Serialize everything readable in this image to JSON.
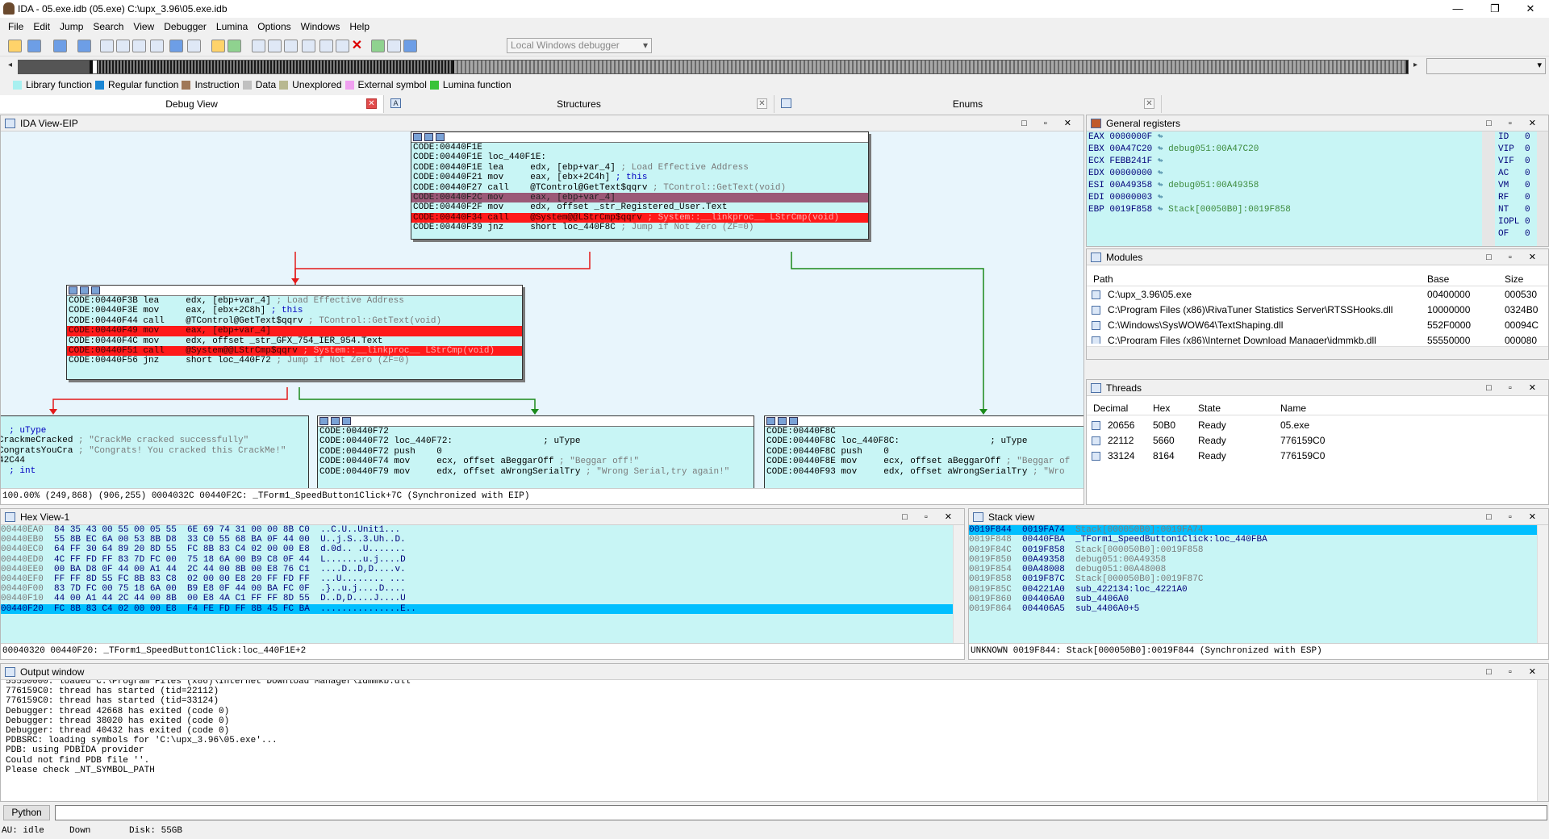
{
  "window": {
    "title": "IDA - 05.exe.idb (05.exe) C:\\upx_3.96\\05.exe.idb",
    "minimize": "—",
    "maximize": "❐",
    "close": "✕"
  },
  "menu": [
    "File",
    "Edit",
    "Jump",
    "Search",
    "View",
    "Debugger",
    "Lumina",
    "Options",
    "Windows",
    "Help"
  ],
  "toolbar": {
    "debugger_select": "Local Windows debugger"
  },
  "legend": [
    {
      "label": "Library function",
      "color": "#a8f0f0"
    },
    {
      "label": "Regular function",
      "color": "#1a86d4"
    },
    {
      "label": "Instruction",
      "color": "#a07858"
    },
    {
      "label": "Data",
      "color": "#c0c0c0"
    },
    {
      "label": "Unexplored",
      "color": "#b8b890"
    },
    {
      "label": "External symbol",
      "color": "#f0a0f0"
    },
    {
      "label": "Lumina function",
      "color": "#39c339"
    }
  ],
  "tabs": [
    {
      "label": "Debug View"
    },
    {
      "label": "Structures"
    },
    {
      "label": "Enums"
    }
  ],
  "ida_view": {
    "title": "IDA View-EIP",
    "nodes": [
      {
        "lines": [
          {
            "t": "CODE:00440F1E"
          },
          {
            "t": "CODE:00440F1E loc_440F1E:"
          },
          {
            "t": "CODE:00440F1E lea     edx, [ebp+var_4]",
            "c": " ; Load Effective Address"
          },
          {
            "t": "CODE:00440F21 mov     eax, [ebx+2C4h]",
            "c": " ; this"
          },
          {
            "t": "CODE:00440F27 call    @TControl@GetText$qqrv",
            "c": " ; TControl::GetText(void)"
          },
          {
            "t": "CODE:00440F2C mov     eax, [ebp+var_4]",
            "k": "cur"
          },
          {
            "t": "CODE:00440F2F mov     edx, offset _str_Registered_User.Text"
          },
          {
            "t": "CODE:00440F34 call    @System@@LStrCmp$qqrv",
            "c": " ; System::__linkproc__ LStrCmp(void)",
            "k": "bp"
          },
          {
            "t": "CODE:00440F39 jnz     short loc_440F8C",
            "c": " ; Jump if Not Zero (ZF=0)"
          }
        ]
      },
      {
        "lines": [
          {
            "t": "CODE:00440F3B lea     edx, [ebp+var_4]",
            "c": " ; Load Effective Address"
          },
          {
            "t": "CODE:00440F3E mov     eax, [ebx+2C8h]",
            "c": " ; this"
          },
          {
            "t": "CODE:00440F44 call    @TControl@GetText$qqrv",
            "c": " ; TControl::GetText(void)"
          },
          {
            "t": "CODE:00440F49 mov     eax, [ebp+var_4]",
            "k": "bp"
          },
          {
            "t": "CODE:00440F4C mov     edx, offset _str_GFX_754_IER_954.Text"
          },
          {
            "t": "CODE:00440F51 call    @System@@LStrCmp$qqrv",
            "c": " ; System::__linkproc__ LStrCmp(void)",
            "k": "bp"
          },
          {
            "t": "CODE:00440F56 jnz     short loc_440F72",
            "c": " ; Jump if Not Zero (ZF=0)"
          }
        ]
      },
      {
        "lines": [
          {
            "t": "  ; uType"
          },
          {
            "t": "CrackmeCracked",
            "c": " ; \"CrackMe cracked successfully\""
          },
          {
            "t": "CongratsYouCra",
            "c": " ; \"Congrats! You cracked this CrackMe!\""
          },
          {
            "t": "42C44"
          },
          {
            "t": "  ; int"
          }
        ]
      },
      {
        "lines": [
          {
            "t": "CODE:00440F72"
          },
          {
            "t": "CODE:00440F72 loc_440F72:                 ; uType"
          },
          {
            "t": "CODE:00440F72 push    0"
          },
          {
            "t": "CODE:00440F74 mov     ecx, offset aBeggarOff",
            "c": " ; \"Beggar off!\""
          },
          {
            "t": "CODE:00440F79 mov     edx, offset aWrongSerialTry",
            "c": " ; \"Wrong Serial,try again!\""
          }
        ]
      },
      {
        "lines": [
          {
            "t": "CODE:00440F8C"
          },
          {
            "t": "CODE:00440F8C loc_440F8C:                 ; uType"
          },
          {
            "t": "CODE:00440F8C push    0"
          },
          {
            "t": "CODE:00440F8E mov     ecx, offset aBeggarOff",
            "c": " ; \"Beggar of"
          },
          {
            "t": "CODE:00440F93 mov     edx, offset aWrongSerialTry",
            "c": " ; \"Wro"
          }
        ]
      }
    ],
    "status": "100.00% (249,868) (906,255) 0004032C 00440F2C: _TForm1_SpeedButton1Click+7C (Synchronized with EIP)"
  },
  "registers": {
    "title": "General registers",
    "rows": [
      {
        "name": "EAX",
        "val": "0000000F",
        "ref": ""
      },
      {
        "name": "EBX",
        "val": "00A47C20",
        "ref": "debug051:00A47C20"
      },
      {
        "name": "ECX",
        "val": "FEBB241F",
        "ref": ""
      },
      {
        "name": "EDX",
        "val": "00000000",
        "ref": ""
      },
      {
        "name": "ESI",
        "val": "00A49358",
        "ref": "debug051:00A49358"
      },
      {
        "name": "EDI",
        "val": "00000003",
        "ref": ""
      },
      {
        "name": "EBP",
        "val": "0019F858",
        "ref": "Stack[00050B0]:0019F858"
      }
    ],
    "flags": [
      {
        "n": "ID",
        "v": "0"
      },
      {
        "n": "VIP",
        "v": "0"
      },
      {
        "n": "VIF",
        "v": "0"
      },
      {
        "n": "AC",
        "v": "0"
      },
      {
        "n": "VM",
        "v": "0"
      },
      {
        "n": "RF",
        "v": "0"
      },
      {
        "n": "NT",
        "v": "0"
      },
      {
        "n": "IOPL",
        "v": "0"
      },
      {
        "n": "OF",
        "v": "0"
      }
    ]
  },
  "modules": {
    "title": "Modules",
    "columns": [
      "Path",
      "Base",
      "Size"
    ],
    "rows": [
      {
        "path": "C:\\upx_3.96\\05.exe",
        "base": "00400000",
        "size": "000530"
      },
      {
        "path": "C:\\Program Files (x86)\\RivaTuner Statistics Server\\RTSSHooks.dll",
        "base": "10000000",
        "size": "0324B0"
      },
      {
        "path": "C:\\Windows\\SysWOW64\\TextShaping.dll",
        "base": "552F0000",
        "size": "00094C"
      },
      {
        "path": "C:\\Program Files (x86)\\Internet Download Manager\\idmmkb.dll",
        "base": "55550000",
        "size": "000080"
      }
    ]
  },
  "threads": {
    "title": "Threads",
    "columns": [
      "Decimal",
      "Hex",
      "State",
      "Name"
    ],
    "rows": [
      {
        "dec": "20656",
        "hex": "50B0",
        "state": "Ready",
        "name": "05.exe"
      },
      {
        "dec": "22112",
        "hex": "5660",
        "state": "Ready",
        "name": "776159C0"
      },
      {
        "dec": "33124",
        "hex": "8164",
        "state": "Ready",
        "name": "776159C0"
      }
    ]
  },
  "hexview": {
    "title": "Hex View-1",
    "rows": [
      {
        "a": "00440EA0",
        "h": "84 35 43 00 55 00 05 55  6E 69 74 31 00 00 8B C0",
        "s": "..C.U..Unit1..."
      },
      {
        "a": "00440EB0",
        "h": "55 8B EC 6A 00 53 8B D8  33 C0 55 68 BA 0F 44 00",
        "s": "U..j.S..3.Uh..D."
      },
      {
        "a": "00440EC0",
        "h": "64 FF 30 64 89 20 8D 55  FC 8B 83 C4 02 00 00 E8",
        "s": "d.0d.. .U......."
      },
      {
        "a": "00440ED0",
        "h": "4C FF FD FF 83 7D FC 00  75 18 6A 00 B9 C8 0F 44",
        "s": "L.......u.j....D"
      },
      {
        "a": "00440EE0",
        "h": "00 BA D8 0F 44 00 A1 44  2C 44 00 8B 00 E8 76 C1",
        "s": "....D..D,D....v."
      },
      {
        "a": "00440EF0",
        "h": "FF FF 8D 55 FC 8B 83 C8  02 00 00 E8 20 FF FD FF",
        "s": "...U........ ..."
      },
      {
        "a": "00440F00",
        "h": "83 7D FC 00 75 18 6A 00  B9 E8 0F 44 00 BA FC 0F",
        "s": ".}..u.j....D...."
      },
      {
        "a": "00440F10",
        "h": "44 00 A1 44 2C 44 00 8B  00 E8 4A C1 FF FF 8D 55",
        "s": "D..D,D....J....U"
      },
      {
        "a": "00440F20",
        "h": "FC 8B 83 C4 02 00 00 E8  F4 FE FD FF 8B 45 FC BA",
        "s": "...............E..",
        "hi": true
      }
    ],
    "status": "00040320 00440F20: _TForm1_SpeedButton1Click:loc_440F1E+2"
  },
  "stack": {
    "title": "Stack view",
    "rows": [
      {
        "a": "0019F844",
        "v": "0019FA74",
        "d": "Stack[000050B0]:0019FA74",
        "hi": true
      },
      {
        "a": "0019F848",
        "v": "00440FBA",
        "d": "_TForm1_SpeedButton1Click:loc_440FBA"
      },
      {
        "a": "0019F84C",
        "v": "0019F858",
        "d": "Stack[000050B0]:0019F858"
      },
      {
        "a": "0019F850",
        "v": "00A49358",
        "d": "debug051:00A49358"
      },
      {
        "a": "0019F854",
        "v": "00A48008",
        "d": "debug051:00A48008"
      },
      {
        "a": "0019F858",
        "v": "0019F87C",
        "d": "Stack[000050B0]:0019F87C"
      },
      {
        "a": "0019F85C",
        "v": "004221A0",
        "d": "sub_422134:loc_4221A0"
      },
      {
        "a": "0019F860",
        "v": "004406A0",
        "d": "sub_4406A0"
      },
      {
        "a": "0019F864",
        "v": "004406A5",
        "d": "sub_4406A0+5"
      }
    ],
    "status": "UNKNOWN 0019F844: Stack[000050B0]:0019F844 (Synchronized with ESP)"
  },
  "output": {
    "title": "Output window",
    "lines": [
      "55550000: loaded C:\\Program Files (x86)\\Internet Download Manager\\idmmkb.dll",
      "776159C0: thread has started (tid=22112)",
      "776159C0: thread has started (tid=33124)",
      "Debugger: thread 42668 has exited (code 0)",
      "Debugger: thread 38020 has exited (code 0)",
      "Debugger: thread 40432 has exited (code 0)",
      "PDBSRC: loading symbols for 'C:\\upx_3.96\\05.exe'...",
      "PDB: using PDBIDA provider",
      "Could not find PDB file ''.",
      "Please check _NT_SYMBOL_PATH"
    ]
  },
  "python_label": "Python",
  "statusbar": {
    "au": "AU:  idle",
    "dir": "Down",
    "disk": "Disk: 55GB"
  }
}
